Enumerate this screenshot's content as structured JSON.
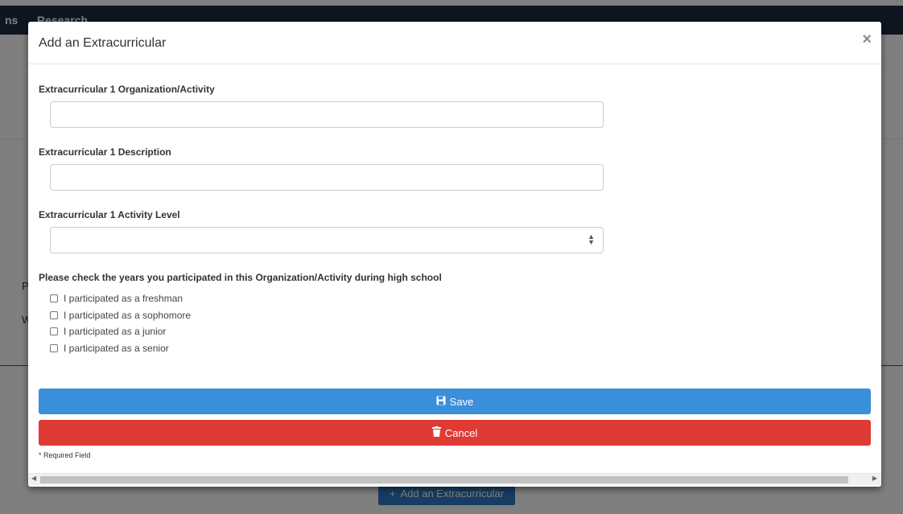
{
  "background": {
    "nav_items": [
      "ns",
      "Research"
    ],
    "side_text": [
      "P",
      "W"
    ],
    "add_button_label": "Add an Extracurricular"
  },
  "modal": {
    "title": "Add an Extracurricular",
    "close_symbol": "×",
    "fields": {
      "organization_label": "Extracurricular 1 Organization/Activity",
      "organization_value": "",
      "description_label": "Extracurricular 1 Description",
      "description_value": "",
      "activity_level_label": "Extracurricular 1 Activity Level",
      "activity_level_value": ""
    },
    "years_prompt": "Please check the years you participated in this Organization/Activity during high school",
    "checkboxes": [
      "I participated as a freshman",
      "I participated as a sophomore",
      "I participated as a junior",
      "I participated as a senior"
    ],
    "save_label": "Save",
    "cancel_label": "Cancel",
    "required_note": "* Required Field"
  },
  "colors": {
    "save": "#3a8fdb",
    "cancel": "#e03a35",
    "topbar": "#1d2d44"
  },
  "icons": {
    "save": "floppy-disk-icon",
    "cancel": "trash-icon",
    "close": "close-icon",
    "add": "plus-icon"
  }
}
